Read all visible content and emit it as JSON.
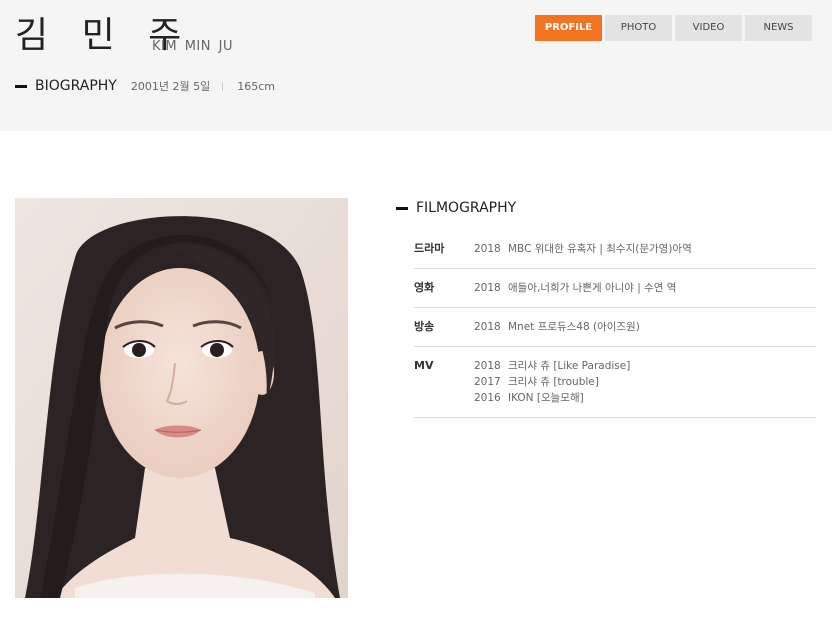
{
  "profile": {
    "name_korean": "김 민 주",
    "name_english": "KIM MIN JU",
    "biography_label": "BIOGRAPHY",
    "birth_date": "2001년 2월 5일",
    "height": "165cm"
  },
  "tabs": [
    {
      "label": "PROFILE",
      "active": true
    },
    {
      "label": "PHOTO",
      "active": false
    },
    {
      "label": "VIDEO",
      "active": false
    },
    {
      "label": "NEWS",
      "active": false
    }
  ],
  "filmography": {
    "title": "FILMOGRAPHY",
    "rows": [
      {
        "category": "드라마",
        "entries": [
          {
            "year": "2018",
            "text": "MBC 위대한 유혹자 | 최수지(문가영)아역"
          }
        ]
      },
      {
        "category": "영화",
        "entries": [
          {
            "year": "2018",
            "text": "애들아,너희가 나쁜게 아니야 | 수연 역"
          }
        ]
      },
      {
        "category": "방송",
        "entries": [
          {
            "year": "2018",
            "text": "Mnet 프로듀스48 (아이즈원)"
          }
        ]
      },
      {
        "category": "MV",
        "entries": [
          {
            "year": "2018",
            "text": "크리샤 츄 [Like Paradise]"
          },
          {
            "year": "2017",
            "text": "크리샤 츄 [trouble]"
          },
          {
            "year": "2016",
            "text": "IKON [오늘모해]"
          }
        ]
      }
    ]
  },
  "colors": {
    "accent": "#f47321",
    "header_bg": "#f5f5f5",
    "tab_bg": "#e3e3e3"
  }
}
